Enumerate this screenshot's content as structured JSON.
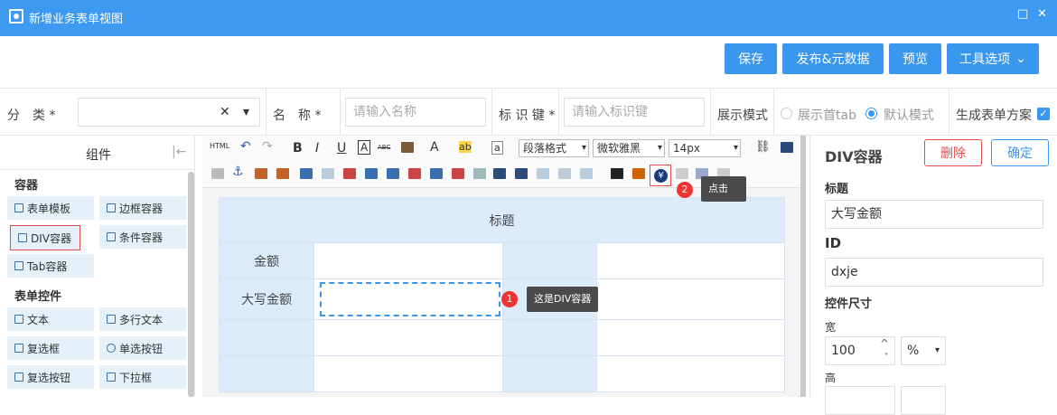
{
  "window": {
    "title": "新增业务表单视图",
    "restore": "□",
    "close": "✕"
  },
  "actions": {
    "save": "保存",
    "publish": "发布&元数据",
    "preview": "预览",
    "tools": "工具选项",
    "tools_caret": "⌄"
  },
  "form": {
    "category_label": "分　类 *",
    "category_clear": "✕",
    "category_caret": "▾",
    "name_label": "名　称 *",
    "name_placeholder": "请输入名称",
    "key_label": "标 识 键 *",
    "key_placeholder": "请输入标识键",
    "display_mode_label": "展示模式",
    "option_first_tab": "展示首tab",
    "option_default": "默认模式",
    "generate_label": "生成表单方案",
    "generate_checked": true
  },
  "left_panel": {
    "title": "组件",
    "collapse": "|←",
    "containers_heading": "容器",
    "containers": [
      "表单模板",
      "边框容器",
      "DIV容器",
      "条件容器",
      "Tab容器"
    ],
    "controls_heading": "表单控件",
    "controls": [
      "文本",
      "多行文本",
      "复选框",
      "单选按钮",
      "复选按钮",
      "下拉框"
    ]
  },
  "toolbar": {
    "html": "HTML",
    "bold": "B",
    "italic": "I",
    "underline": "U",
    "font_color": "A",
    "strike": "ABC",
    "font_letter": "A",
    "hilite": "ab",
    "small_a": "a",
    "paragraph": "段落格式",
    "font": "微软雅黑",
    "size": "14px",
    "yuan": "¥"
  },
  "canvas": {
    "table_title": "标题",
    "row1_label": "金额",
    "row2_label": "大写金额"
  },
  "tooltips": {
    "step1_badge": "1",
    "step1_text": "这是DIV容器",
    "step2_badge": "2",
    "step2_text": "点击"
  },
  "right_panel": {
    "title": "DIV容器",
    "delete": "删除",
    "confirm": "确定",
    "title_label": "标题",
    "title_value": "大写金额",
    "id_label": "ID",
    "id_value": "dxje",
    "size_label": "控件尺寸",
    "width_label": "宽",
    "width_value": "100",
    "width_unit": "%",
    "height_label": "高"
  },
  "colors": {
    "accent": "#3a97ee",
    "titlebar": "#3e9af1",
    "danger": "#e34c4c",
    "cell_blue": "#dcebfa"
  }
}
